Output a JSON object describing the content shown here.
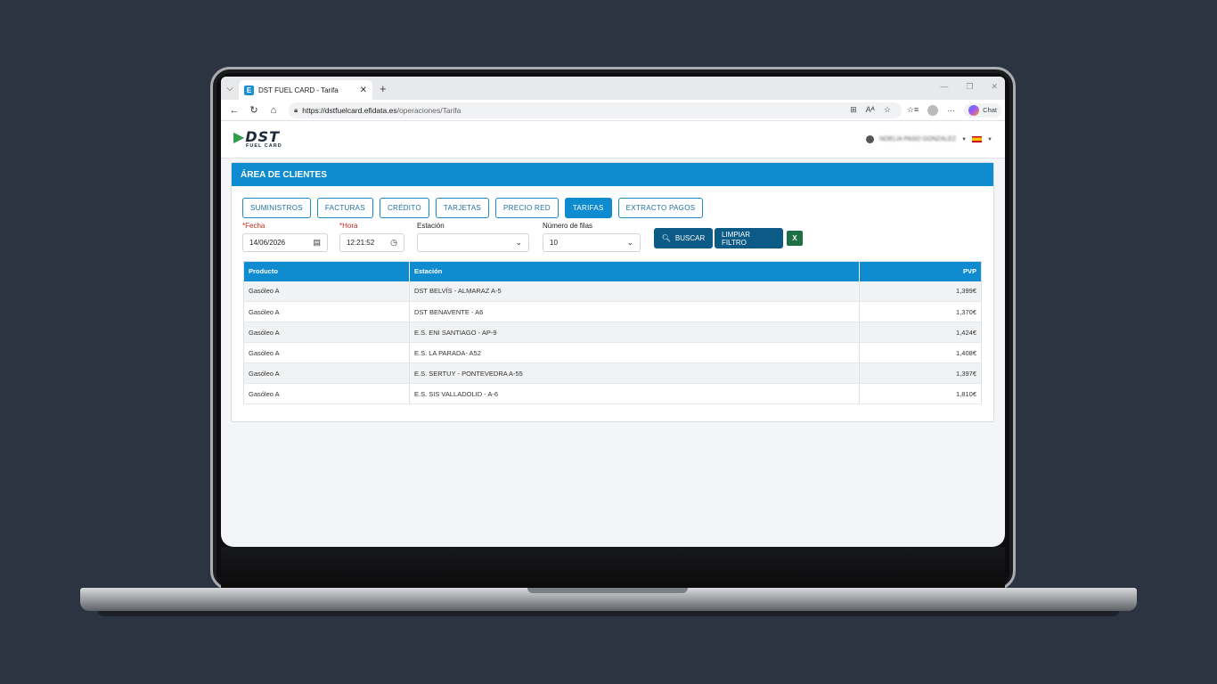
{
  "browser": {
    "tab_title": "DST FUEL CARD - Tarifa",
    "tab_favicon_letter": "E",
    "url_host": "https://dstfuelcard.efidata.es",
    "url_path": "/operaciones/Tarifa",
    "chat_label": "Chat"
  },
  "header": {
    "logo_text": "DST",
    "logo_subtext": "FUEL CARD",
    "user_name": "NOELIA PASO GONZALEZ",
    "language": "es"
  },
  "panel": {
    "title": "ÁREA DE CLIENTES",
    "tabs": [
      {
        "label": "SUMINISTROS",
        "active": false
      },
      {
        "label": "FACTURAS",
        "active": false
      },
      {
        "label": "CRÉDITO",
        "active": false
      },
      {
        "label": "TARJETAS",
        "active": false
      },
      {
        "label": "PRECIO RED",
        "active": false
      },
      {
        "label": "TARIFAS",
        "active": true
      },
      {
        "label": "EXTRACTO PAGOS",
        "active": false
      }
    ]
  },
  "filters": {
    "fecha_label": "Fecha",
    "fecha_value": "14/06/2026",
    "hora_label": "Hora",
    "hora_value": "12:21:52",
    "estacion_label": "Estación",
    "estacion_value": "",
    "filas_label": "Número de filas",
    "filas_value": "10",
    "buscar_label": "BUSCAR",
    "limpiar_label": "LIMPIAR FILTRO",
    "excel_letter": "X"
  },
  "table": {
    "columns": [
      "Producto",
      "Estación",
      "PVP"
    ],
    "rows": [
      [
        "Gasóleo A",
        "DST BELVÍS - ALMARAZ A-5",
        "1,399€"
      ],
      [
        "Gasóleo A",
        "DST BENAVENTE - A6",
        "1,370€"
      ],
      [
        "Gasóleo A",
        "E.S. ENI SANTIAGO - AP-9",
        "1,424€"
      ],
      [
        "Gasóleo A",
        "E.S. LA PARADA- A52",
        "1,408€"
      ],
      [
        "Gasóleo A",
        "E.S. SERTUY - PONTEVEDRA A-55",
        "1,397€"
      ],
      [
        "Gasóleo A",
        "E.S. SIS VALLADOLID - A-6",
        "1,810€"
      ]
    ]
  },
  "colors": {
    "primary": "#0f8ccf",
    "button_dark": "#0c5b86",
    "required": "#c0271e",
    "background": "#2b3440"
  }
}
